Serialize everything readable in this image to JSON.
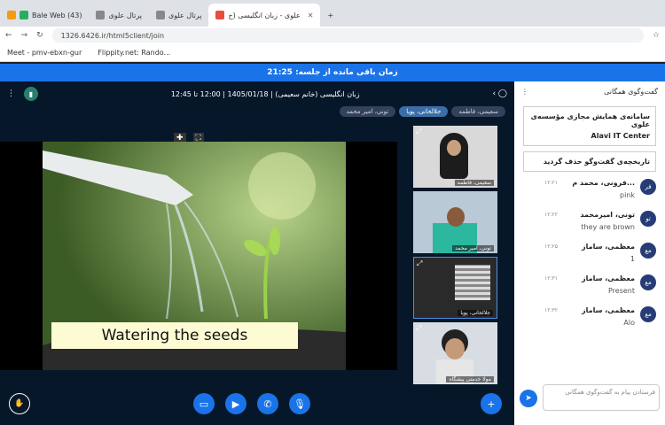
{
  "browser": {
    "tabs": [
      {
        "label": "Bale Web (43)",
        "color": "#27ae60"
      },
      {
        "label": "پرتال علوی",
        "color": "#888888"
      },
      {
        "label": "پرتال علوی",
        "color": "#888888"
      },
      {
        "label": "علوی - زبان انگلیسی (خ",
        "color": "#e74c3c",
        "active": true
      }
    ],
    "url": "1326.6426.ir/html5client/join",
    "bookmarks": [
      "Meet - pmv-ebxn-gur",
      "Flippity.net: Rando..."
    ]
  },
  "session": {
    "timer": "زمان باقی مانده از جلسه: 21:25",
    "title": "زبان انگلیسی (خانم سعیمی) | 1405/01/18 | 12:00 تا 12:45",
    "chips": [
      "سعیمی، فاطمه",
      "جلالخانی، پویا",
      "تونی، امیر محمد"
    ]
  },
  "presentation": {
    "caption": "Watering the seeds"
  },
  "thumbnails": [
    {
      "name": "سعیمی، فاطمه"
    },
    {
      "name": "تونی، امیر محمد"
    },
    {
      "name": "جلالخانی، پویا"
    },
    {
      "name": "مولا خدمتی پیشگاه"
    }
  ],
  "chat": {
    "header": "گفت‌وگوی همگانی",
    "welcome": "سامانه‌ی همایش مجازی مؤسسه‌ی علوی",
    "welcome_sub": "Alavi IT Center",
    "cleared": "تاریخچه‌ی گفت‌وگو حذف گردید",
    "messages": [
      {
        "initials": "فر",
        "name": "فرونی، محمد م...",
        "time": "۱۲:۲۱",
        "text": "pink"
      },
      {
        "initials": "تو",
        "name": "تونی، امیرمحمد",
        "time": "۱۲:۲۲",
        "text": "they are brown"
      },
      {
        "initials": "مع",
        "name": "معظمی، ساماز",
        "time": "۱۲:۲۵",
        "text": "1"
      },
      {
        "initials": "مع",
        "name": "معظمی، ساماز",
        "time": "۱۲:۳۱",
        "text": "Present"
      },
      {
        "initials": "مع",
        "name": "معظمی، ساماز",
        "time": "۱۲:۳۲",
        "text": "Alo"
      }
    ],
    "input_placeholder": "فرستادن پیام به گفت‌وگوی همگانی"
  }
}
